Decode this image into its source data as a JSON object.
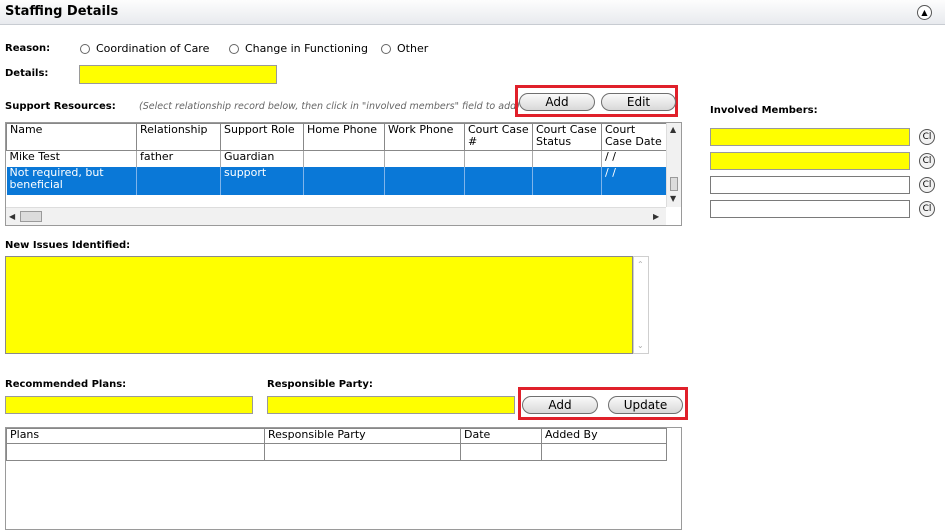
{
  "header": {
    "title": "Staffing Details"
  },
  "reason": {
    "label": "Reason:",
    "options": [
      "Coordination of Care",
      "Change in Functioning",
      "Other"
    ]
  },
  "details": {
    "label": "Details:",
    "value": ""
  },
  "support": {
    "label": "Support Resources:",
    "hint": "(Select relationship record below, then click in \"involved members\" field to add)",
    "add_label": "Add",
    "edit_label": "Edit",
    "columns": [
      "Name",
      "Relationship",
      "Support Role",
      "Home Phone",
      "Work Phone",
      "Court Case #",
      "Court Case Status",
      "Court Case Date"
    ],
    "rows": [
      [
        "Mike Test",
        "father",
        "Guardian",
        "",
        "",
        "",
        "",
        " /  /"
      ],
      [
        "Not required, but beneficial",
        "",
        "support",
        "",
        "",
        "",
        "",
        " /  /"
      ]
    ]
  },
  "involved": {
    "label": "Involved Members:",
    "clear_label": "Cl",
    "fields": [
      "",
      "",
      "",
      ""
    ]
  },
  "issues": {
    "label": "New Issues Identified:",
    "value": ""
  },
  "plans": {
    "recommended_label": "Recommended Plans:",
    "responsible_label": "Responsible Party:",
    "add_label": "Add",
    "update_label": "Update",
    "columns": [
      "Plans",
      "Responsible Party",
      "Date",
      "Added By"
    ]
  },
  "colors": {
    "required_field": "#ffff00",
    "selection": "#0a78d7",
    "highlight_border": "#e0202a"
  }
}
